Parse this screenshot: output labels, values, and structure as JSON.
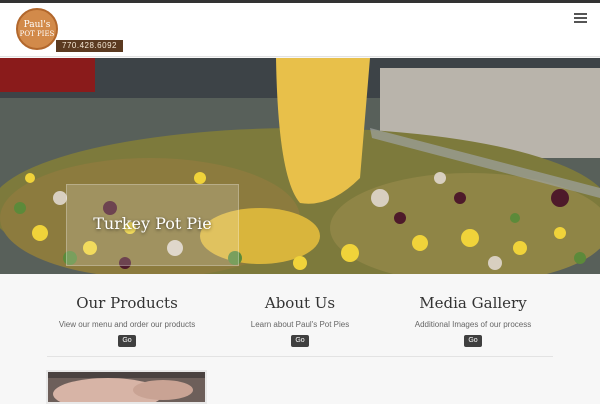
{
  "header": {
    "logo_line1": "Paul's",
    "logo_line2": "POT PIES",
    "phone": "770.428.6092"
  },
  "hero": {
    "title": "Turkey Pot Pie"
  },
  "features": [
    {
      "title": "Our Products",
      "description": "View our menu and order our products",
      "button": "Go"
    },
    {
      "title": "About Us",
      "description": "Learn about Paul's Pot Pies",
      "button": "Go"
    },
    {
      "title": "Media Gallery",
      "description": "Additional Images of our process",
      "button": "Go"
    }
  ],
  "colors": {
    "logo_orange": "#d28a4a",
    "phone_bar": "#5b3a20",
    "button_dark": "#3f3f3f"
  },
  "icons": [
    "hamburger-menu-icon"
  ]
}
